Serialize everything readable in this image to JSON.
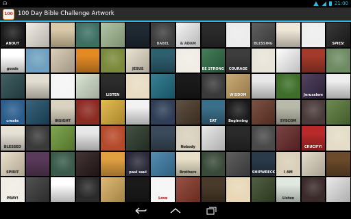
{
  "status_bar": {
    "time": "21:00",
    "notification_icon": "headset-icon"
  },
  "app": {
    "title": "100 Day Bible Challenge Artwork",
    "icon_text": "100"
  },
  "nav": {
    "back": "back-icon",
    "home": "home-icon",
    "recents": "recents-icon"
  },
  "colors": {
    "accent": "#33b5e5",
    "actionbar": "#2b2b2b"
  },
  "tiles": [
    {
      "bg": "#1a1a1a",
      "fg": "#ffffff",
      "text": "ABOUT"
    },
    {
      "bg": "#f0ebe2",
      "fg": "#a33",
      "text": ""
    },
    {
      "bg": "#d9c9a8",
      "fg": "#333",
      "text": ""
    },
    {
      "bg": "#3e6f63",
      "fg": "#e0e6d0",
      "text": ""
    },
    {
      "bg": "#a7bf98",
      "fg": "#fff",
      "text": ""
    },
    {
      "bg": "#1f2a33",
      "fg": "#fff",
      "text": ""
    },
    {
      "bg": "#3e3e3e",
      "fg": "#cfcfcf",
      "text": "BABEL"
    },
    {
      "bg": "#f4f4f4",
      "fg": "#555",
      "text": "& ADAM"
    },
    {
      "bg": "#2b2b2b",
      "fg": "#eee",
      "text": ""
    },
    {
      "bg": "#ececec",
      "fg": "#333",
      "text": ""
    },
    {
      "bg": "#4a4a4a",
      "fg": "#ddd",
      "text": "BLESSING"
    },
    {
      "bg": "#efe7d8",
      "fg": "#333",
      "text": ""
    },
    {
      "bg": "#eeeeee",
      "fg": "#444",
      "text": ""
    },
    {
      "bg": "#1e1e1e",
      "fg": "#fff",
      "text": "SPIES!"
    },
    {
      "bg": "#ffffff",
      "fg": "#333",
      "text": "goods"
    },
    {
      "bg": "#6fa0c0",
      "fg": "#fff",
      "text": ""
    },
    {
      "bg": "#d7c9b0",
      "fg": "#333",
      "text": ""
    },
    {
      "bg": "#e38a24",
      "fg": "#fff",
      "text": ""
    },
    {
      "bg": "#7a8a3a",
      "fg": "#fff",
      "text": ""
    },
    {
      "bg": "#e8e0cc",
      "fg": "#333",
      "text": "JESUS"
    },
    {
      "bg": "#2e5f6e",
      "fg": "#fff",
      "text": ""
    },
    {
      "bg": "#f0ede6",
      "fg": "#333",
      "text": ""
    },
    {
      "bg": "#2d6c45",
      "fg": "#fff",
      "text": "BE STRONG"
    },
    {
      "bg": "#3d3d3d",
      "fg": "#fff",
      "text": "COURAGE"
    },
    {
      "bg": "#e9e4d8",
      "fg": "#333",
      "text": ""
    },
    {
      "bg": "#ffffff",
      "fg": "#333",
      "text": ""
    },
    {
      "bg": "#a33a2a",
      "fg": "#fff",
      "text": ""
    },
    {
      "bg": "#6e8a63",
      "fg": "#fff",
      "text": ""
    },
    {
      "bg": "#2a4b4f",
      "fg": "#fff",
      "text": ""
    },
    {
      "bg": "#e2ddd0",
      "fg": "#333",
      "text": ""
    },
    {
      "bg": "#f5f5f5",
      "fg": "#c33",
      "text": ""
    },
    {
      "bg": "#d8e4d0",
      "fg": "#333",
      "text": ""
    },
    {
      "bg": "#2c2c2c",
      "fg": "#fff",
      "text": "LISTEN"
    },
    {
      "bg": "#e8dcc4",
      "fg": "#333",
      "text": ""
    },
    {
      "bg": "#1e6f85",
      "fg": "#fff",
      "text": ""
    },
    {
      "bg": "#1a1a1a",
      "fg": "#fff",
      "text": ""
    },
    {
      "bg": "#3a3a3a",
      "fg": "#fff",
      "text": ""
    },
    {
      "bg": "#c4a062",
      "fg": "#fff",
      "text": "WISDOM"
    },
    {
      "bg": "#e7e7e7",
      "fg": "#333",
      "text": ""
    },
    {
      "bg": "#3e6e2a",
      "fg": "#fff",
      "text": ""
    },
    {
      "bg": "#3a2a4a",
      "fg": "#fff",
      "text": "Jerusalem"
    },
    {
      "bg": "#eeeeee",
      "fg": "#333",
      "text": ""
    },
    {
      "bg": "#2b5d8c",
      "fg": "#fff",
      "text": "create"
    },
    {
      "bg": "#1e4f6a",
      "fg": "#fff",
      "text": ""
    },
    {
      "bg": "#d9d2c0",
      "fg": "#333",
      "text": "INSIGHT"
    },
    {
      "bg": "#8b2a22",
      "fg": "#fff",
      "text": ""
    },
    {
      "bg": "#e0b23b",
      "fg": "#fff",
      "text": ""
    },
    {
      "bg": "#f2f2f2",
      "fg": "#333",
      "text": ""
    },
    {
      "bg": "#2f3e56",
      "fg": "#fff",
      "text": ""
    },
    {
      "bg": "#4a3a2a",
      "fg": "#fff",
      "text": ""
    },
    {
      "bg": "#3a6f8a",
      "fg": "#fff",
      "text": "EAT"
    },
    {
      "bg": "#1a1a1a",
      "fg": "#fff",
      "text": "Beginning"
    },
    {
      "bg": "#6b3a2a",
      "fg": "#fff",
      "text": ""
    },
    {
      "bg": "#b9b9a9",
      "fg": "#333",
      "text": "SYSCOM"
    },
    {
      "bg": "#4a3a3a",
      "fg": "#fff",
      "text": ""
    },
    {
      "bg": "#5a7a3a",
      "fg": "#fff",
      "text": ""
    },
    {
      "bg": "#e6e1d5",
      "fg": "#333",
      "text": "BLESSED"
    },
    {
      "bg": "#3a3a3a",
      "fg": "#fff",
      "text": ""
    },
    {
      "bg": "#6e9a3a",
      "fg": "#fff",
      "text": ""
    },
    {
      "bg": "#e7e7e7",
      "fg": "#333",
      "text": ""
    },
    {
      "bg": "#b54a2a",
      "fg": "#fff",
      "text": ""
    },
    {
      "bg": "#2a3a2a",
      "fg": "#fff",
      "text": ""
    },
    {
      "bg": "#3a4a5a",
      "fg": "#fff",
      "text": ""
    },
    {
      "bg": "#d8d0bd",
      "fg": "#333",
      "text": "Nobody"
    },
    {
      "bg": "#e8e8e8",
      "fg": "#333",
      "text": ""
    },
    {
      "bg": "#2a2a2a",
      "fg": "#fff",
      "text": ""
    },
    {
      "bg": "#4a4a4a",
      "fg": "#fff",
      "text": ""
    },
    {
      "bg": "#6a2a2a",
      "fg": "#fff",
      "text": ""
    },
    {
      "bg": "#b82a2a",
      "fg": "#fff",
      "text": "CRUCIFY!"
    },
    {
      "bg": "#e4dcc6",
      "fg": "#333",
      "text": ""
    },
    {
      "bg": "#e8dcc4",
      "fg": "#333",
      "text": "SPIRIT"
    },
    {
      "bg": "#5a3a5a",
      "fg": "#fff",
      "text": ""
    },
    {
      "bg": "#3a5a4a",
      "fg": "#fff",
      "text": ""
    },
    {
      "bg": "#2a1a1a",
      "fg": "#fff",
      "text": ""
    },
    {
      "bg": "#e0a040",
      "fg": "#fff",
      "text": ""
    },
    {
      "bg": "#2a2a3a",
      "fg": "#fff",
      "text": "paul saul"
    },
    {
      "bg": "#3e7fa8",
      "fg": "#fff",
      "text": ""
    },
    {
      "bg": "#e8e0c8",
      "fg": "#333",
      "text": "Brothers"
    },
    {
      "bg": "#3a4a3a",
      "fg": "#fff",
      "text": ""
    },
    {
      "bg": "#4a4a4a",
      "fg": "#fff",
      "text": ""
    },
    {
      "bg": "#2a3a4a",
      "fg": "#fff",
      "text": "SHIPWRECK"
    },
    {
      "bg": "#d9cfb8",
      "fg": "#333",
      "text": "I AM"
    },
    {
      "bg": "#e2d9c4",
      "fg": "#333",
      "text": ""
    },
    {
      "bg": "#6a4a2a",
      "fg": "#fff",
      "text": ""
    },
    {
      "bg": "#f0ede6",
      "fg": "#333",
      "text": "PRAY!"
    },
    {
      "bg": "#3a3a3a",
      "fg": "#fff",
      "text": ""
    },
    {
      "bg": "#ffffff",
      "fg": "#c33",
      "text": ""
    },
    {
      "bg": "#2a2a2a",
      "fg": "#fff",
      "text": ""
    },
    {
      "bg": "#d9b060",
      "fg": "#fff",
      "text": ""
    },
    {
      "bg": "#1a1a1a",
      "fg": "#fff",
      "text": ""
    },
    {
      "bg": "#f5f5f5",
      "fg": "#c33",
      "text": "Love"
    },
    {
      "bg": "#8a3a2a",
      "fg": "#fff",
      "text": ""
    },
    {
      "bg": "#4a3a2a",
      "fg": "#fff",
      "text": ""
    },
    {
      "bg": "#e8d8b8",
      "fg": "#333",
      "text": ""
    },
    {
      "bg": "#3a4a2a",
      "fg": "#fff",
      "text": ""
    },
    {
      "bg": "#e0e8e0",
      "fg": "#333",
      "text": "Listen"
    },
    {
      "bg": "#3a2a2a",
      "fg": "#fff",
      "text": ""
    },
    {
      "bg": "#e8e8e8",
      "fg": "#333",
      "text": ""
    }
  ]
}
